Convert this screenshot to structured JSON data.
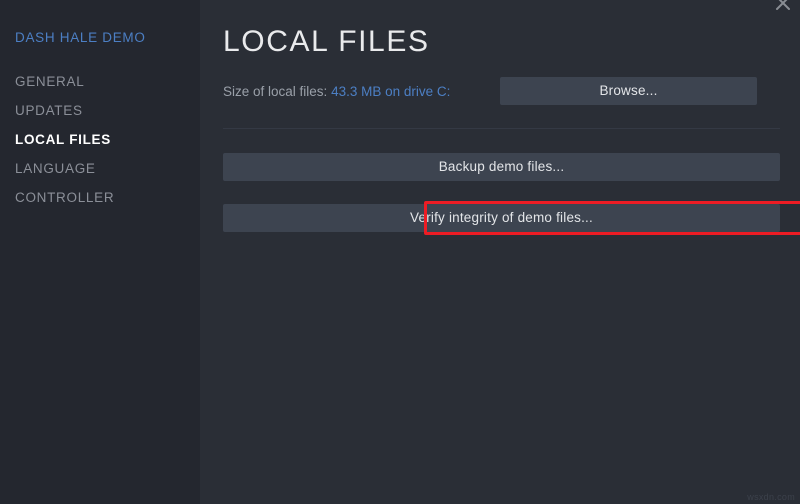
{
  "window": {
    "background_color": "#282c34",
    "close_icon": "close-icon",
    "watermark": "wsxdn.com"
  },
  "sidebar": {
    "background_color": "#24272f",
    "game_title": "DASH HALE DEMO",
    "game_title_color": "#4c7fc4",
    "items": [
      {
        "label": "GENERAL",
        "active": false
      },
      {
        "label": "UPDATES",
        "active": false
      },
      {
        "label": "LOCAL FILES",
        "active": true
      },
      {
        "label": "LANGUAGE",
        "active": false
      },
      {
        "label": "CONTROLLER",
        "active": false
      }
    ]
  },
  "main": {
    "title": "LOCAL FILES",
    "size_label": "Size of local files:",
    "size_value": "43.3 MB on drive C:",
    "size_value_color": "#4c7fc4",
    "browse_button": "Browse...",
    "backup_button": "Backup demo files...",
    "verify_button": "Verify integrity of demo files...",
    "button_color": "#3d4450",
    "highlight_color": "#ed1c24"
  }
}
